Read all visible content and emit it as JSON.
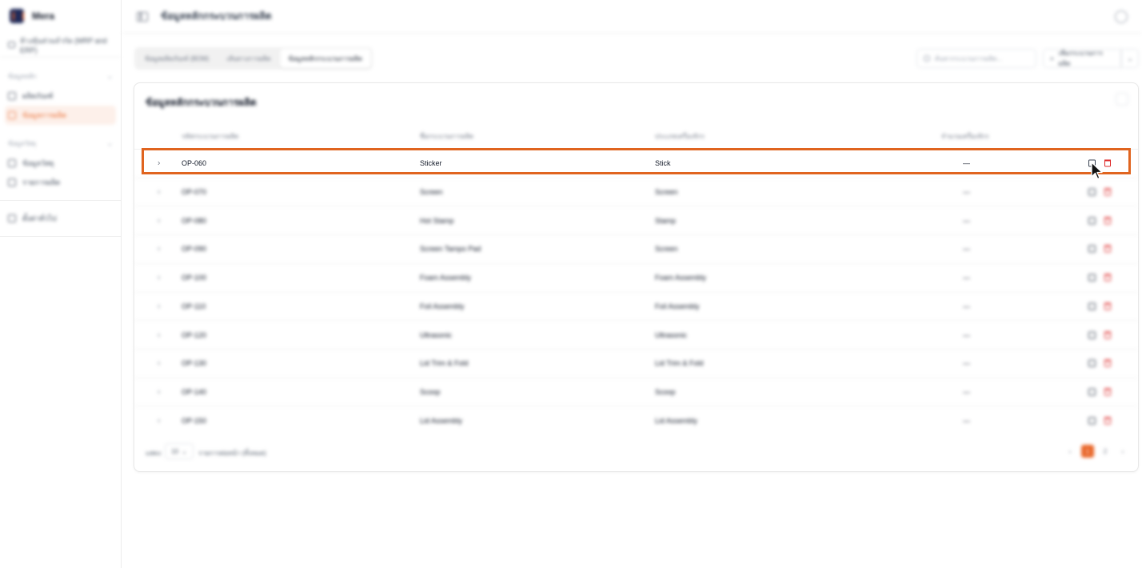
{
  "brand": {
    "name": "Mera"
  },
  "sidebar": {
    "org": "ห้างหุ้นส่วนจำกัด (MRP and ERP)",
    "groups": [
      {
        "title": "ข้อมูลหลัก",
        "items": [
          {
            "label": "ผลิตภัณฑ์"
          },
          {
            "label": "ข้อมูลการผลิต"
          }
        ]
      },
      {
        "title": "ข้อมูลวัสดุ",
        "items": [
          {
            "label": "ข้อมูลวัสดุ"
          },
          {
            "label": "รายการผลิต"
          }
        ]
      }
    ],
    "bottom_item": "ตั้งค่าทั่วไป"
  },
  "topbar": {
    "title": "ข้อมูลหลักกระบวนการผลิต"
  },
  "tabs": [
    {
      "label": "ข้อมูลผลิตภัณฑ์ (BOM)"
    },
    {
      "label": "เส้นทางการผลิต"
    },
    {
      "label": "ข้อมูลหลักกระบวนการผลิต"
    }
  ],
  "search": {
    "placeholder": "ค้นหากระบวนการผลิต..."
  },
  "toolbar": {
    "add_label": "เพิ่มกระบวนการผลิต",
    "add_icon": "plus-icon",
    "more_icon": "chevron-down-icon"
  },
  "card": {
    "title": "ข้อมูลหลักกระบวนการผลิต",
    "columns": [
      "รหัสกระบวนการผลิต",
      "ชื่อกระบวนการผลิต",
      "ประเภทเครื่องจักร",
      "จำนวนเครื่องจักร"
    ],
    "rows": [
      {
        "code": "OP-060",
        "name": "Sticker",
        "type": "Stick",
        "count": "—"
      },
      {
        "code": "OP-070",
        "name": "Screen",
        "type": "Screen",
        "count": "—"
      },
      {
        "code": "OP-080",
        "name": "Hot Stamp",
        "type": "Stamp",
        "count": "—"
      },
      {
        "code": "OP-090",
        "name": "Screen Tampo Pad",
        "type": "Screen",
        "count": "—"
      },
      {
        "code": "OP-100",
        "name": "Foam Assembly",
        "type": "Foam Assembly",
        "count": "—"
      },
      {
        "code": "OP-110",
        "name": "Foil Assembly",
        "type": "Foil Assembly",
        "count": "—"
      },
      {
        "code": "OP-120",
        "name": "Ultrasonic",
        "type": "Ultrasonic",
        "count": "—"
      },
      {
        "code": "OP-130",
        "name": "Lid Trim & Fold",
        "type": "Lid Trim & Fold",
        "count": "—"
      },
      {
        "code": "OP-140",
        "name": "Scoop",
        "type": "Scoop",
        "count": "—"
      },
      {
        "code": "OP-150",
        "name": "Lid Assembly",
        "type": "Lid Assembly",
        "count": "—"
      }
    ]
  },
  "footer": {
    "rows_label": "แสดง",
    "page_size": "10",
    "rows_info": "รายการต่อหน้า (ทั้งหมด)",
    "pages": [
      "1",
      "2"
    ],
    "current_page": "1",
    "prev_icon": "chevron-left-icon",
    "next_icon": "chevron-right-icon"
  },
  "colors": {
    "accent": "#e9672a",
    "highlight": "#e0641f",
    "danger": "#dc2626"
  }
}
